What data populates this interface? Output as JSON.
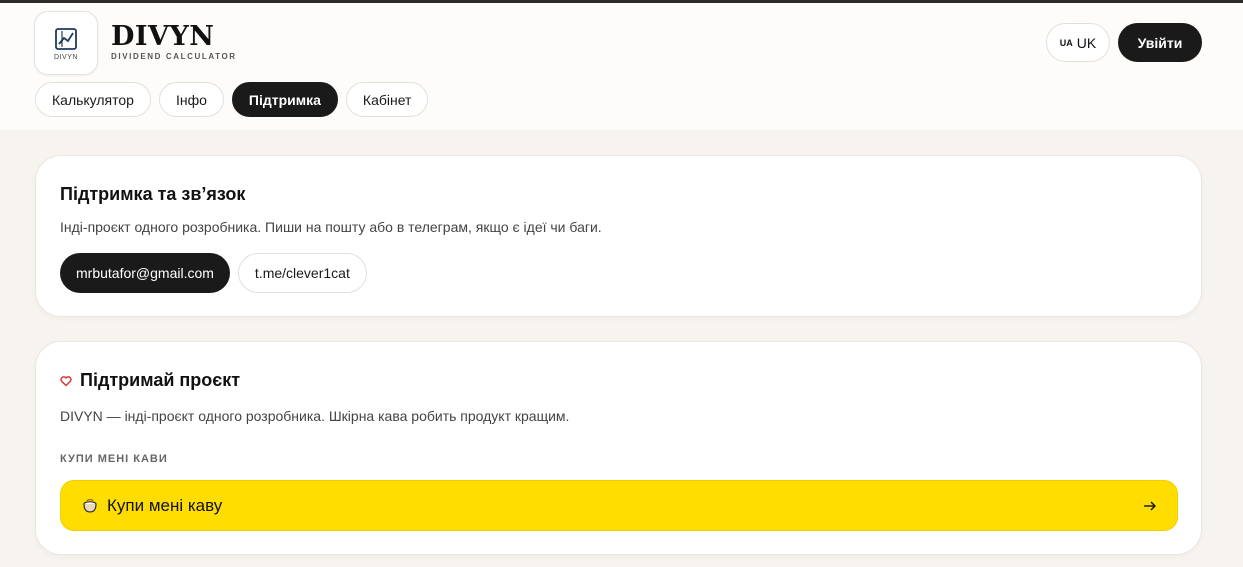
{
  "header": {
    "logo_small_text": "DIVYN",
    "brand_name": "DIVYN",
    "brand_subtitle": "DIVIDEND CALCULATOR",
    "lang_flag": "UA",
    "lang_label": "UK",
    "login_label": "Увійти"
  },
  "nav": {
    "tabs": [
      {
        "label": "Калькулятор",
        "active": false
      },
      {
        "label": "Інфо",
        "active": false
      },
      {
        "label": "Підтримка",
        "active": true
      },
      {
        "label": "Кабінет",
        "active": false
      }
    ]
  },
  "support": {
    "title": "Підтримка та зв’язок",
    "description": "Інді-проєкт одного розробника. Пиши на пошту або в телеграм, якщо є ідеї чи баги.",
    "email": "mrbutafor@gmail.com",
    "telegram": "t.me/clever1cat"
  },
  "donate": {
    "icon": "heart-icon",
    "title": "Підтримай проєкт",
    "description": "DIVYN — інді-проєкт одного розробника. Шкірна кава робить продукт кращим.",
    "section_label": "КУПИ МЕНІ КАВИ",
    "button_label": "Купи мені каву",
    "button_icon": "coffee-cup-icon",
    "arrow_icon": "arrow-right-icon"
  },
  "colors": {
    "accent_yellow": "#ffdd00",
    "dark": "#1a1a1a",
    "background": "#f7f4ef",
    "heart": "#d93838"
  }
}
